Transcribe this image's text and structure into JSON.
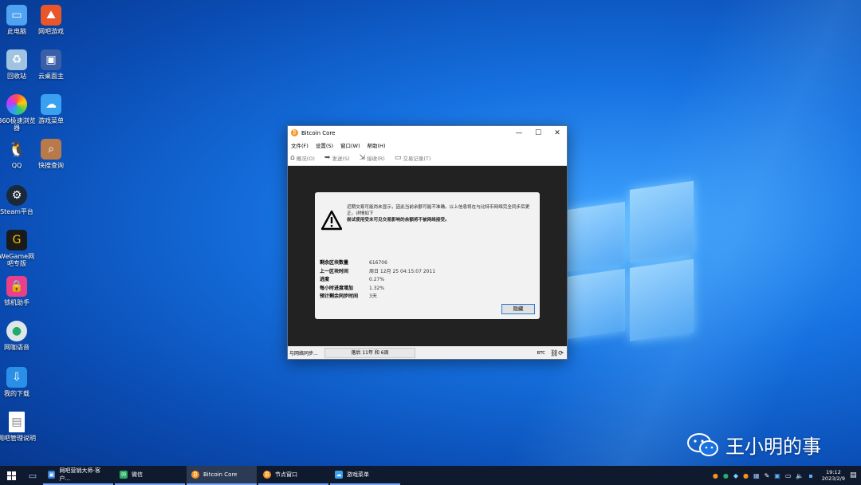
{
  "desktop": {
    "icons": [
      {
        "label": "此电脑",
        "icon": "computer-icon"
      },
      {
        "label": "网吧游戏",
        "icon": "netbar-game-icon"
      },
      {
        "label": "回收站",
        "icon": "recycle-bin-icon"
      },
      {
        "label": "云桌面主",
        "icon": "cloud-desktop-icon"
      },
      {
        "label": "360极速浏览器",
        "icon": "360-browser-icon"
      },
      {
        "label": "游戏菜单",
        "icon": "game-menu-icon"
      },
      {
        "label": "QQ",
        "icon": "qq-icon"
      },
      {
        "label": "快搜查询",
        "icon": "search-app-icon"
      },
      {
        "label": "Steam平台",
        "icon": "steam-icon"
      },
      {
        "label": "WeGame网吧专版",
        "icon": "wegame-icon"
      },
      {
        "label": "锁机助手",
        "icon": "lock-app-icon"
      },
      {
        "label": "网咖语音",
        "icon": "voice-icon"
      },
      {
        "label": "我的下载",
        "icon": "download-icon"
      },
      {
        "label": "网吧管理说明",
        "icon": "document-icon"
      }
    ]
  },
  "window": {
    "title": "Bitcoin Core",
    "menu": [
      "文件(F)",
      "设置(S)",
      "窗口(W)",
      "帮助(H)"
    ],
    "toolbar": [
      "概况(O)",
      "发送(S)",
      "接收(R)",
      "交易记录(T)"
    ],
    "modal": {
      "line1": "近期交易可能尚未显示，因此当前余额可能不准确。以上信息将在与比特币网络完全同步后更正。详情如下",
      "line2": "尝试使用受未可见交易影响的余额将不被网络接受。",
      "stats": [
        {
          "key": "剩余区块数量",
          "value": "616706"
        },
        {
          "key": "上一区块时间",
          "value": "周日 12月 25 04:15:07 2011"
        },
        {
          "key": "进度",
          "value": "0.27%"
        },
        {
          "key": "每小时进度增加",
          "value": "1.32%"
        },
        {
          "key": "预计剩余同步时间",
          "value": "3天"
        }
      ],
      "hide_button": "隐藏"
    },
    "status": {
      "sync_text": "与网络同步...",
      "progress_text": "落后 11年 和 6周",
      "unit": "BTC"
    }
  },
  "watermark": "王小明的事",
  "taskbar": {
    "tasks": [
      {
        "label": "网吧营销大师-客户...",
        "color": "#2d7de0"
      },
      {
        "label": "微信",
        "color": "#2aae67"
      },
      {
        "label": "Bitcoin Core",
        "color": "#f7931a"
      },
      {
        "label": "节点窗口",
        "color": "#f7931a"
      },
      {
        "label": "游戏菜单",
        "color": "#3aa0f0"
      }
    ],
    "time": "19:12",
    "date": "2023/2/9"
  }
}
